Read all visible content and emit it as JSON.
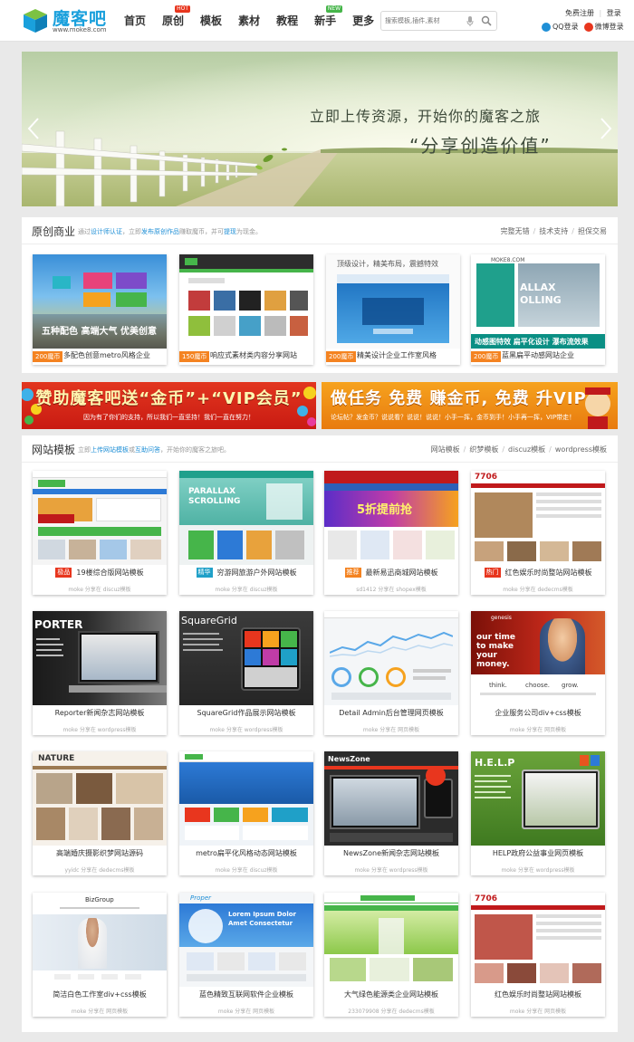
{
  "header": {
    "logo_text": "魔客吧",
    "logo_url": "www.moke8.com",
    "nav": [
      {
        "label": "首页"
      },
      {
        "label": "原创",
        "badge": "HOT"
      },
      {
        "label": "模板"
      },
      {
        "label": "素材"
      },
      {
        "label": "教程"
      },
      {
        "label": "新手",
        "badge": "NEW"
      },
      {
        "label": "更多"
      }
    ],
    "search_placeholder": "搜索模板,插件,素材",
    "register": "免费注册",
    "login": "登录",
    "qq_login": "QQ登录",
    "weibo_login": "微博登录"
  },
  "banner": {
    "headline": "立即上传资源，开始你的魔客之旅",
    "slogan": "“分享创造价值”"
  },
  "original": {
    "title": "原创商业",
    "desc_1": "通过",
    "desc_link_1": "设计师认证",
    "desc_2": "，立即",
    "desc_link_2": "发布原创作品",
    "desc_3": "赚取魔币，并可",
    "desc_link_3": "提现",
    "desc_4": "为现金。",
    "links": [
      "完整无错",
      "技术支持",
      "担保交易"
    ],
    "items": [
      {
        "price": "200魔币",
        "name": "多配色创意metro风格企业",
        "overlay_1": "五种配色 高端大气 优美创意"
      },
      {
        "price": "150魔币",
        "name": "响应式素材类内容分享网站",
        "overlay_1": ""
      },
      {
        "price": "200魔币",
        "name": "精美设计企业工作室风格",
        "overlay_1": "顶级设计，精美布局，震撼特效"
      },
      {
        "price": "200魔币",
        "name": "蓝黑扁平动感网站企业",
        "overlay_1": "动感图特效  扁平化设计  瀑布流效果",
        "overlay_2": "ALLAX",
        "overlay_3": "OLLING",
        "logo": "MOKE8.COM"
      }
    ]
  },
  "ads": {
    "ad1_title": "赞助魔客吧送“金币”+“VIP会员”",
    "ad1_sub": "因为有了你们的支持，所以我们一直坚持！我们一直在努力！",
    "ad2_title": "做任务 免费 赚金币, 免费 升VIP",
    "ad2_sub": "论坛帖？发金币？说说看？说说！说说！小手一挥，金币到手！小手再一挥，VIP带走！"
  },
  "templates": {
    "title": "网站模板",
    "desc_1": "立即",
    "desc_link_1": "上传网站模板",
    "desc_2": "或",
    "desc_link_2": "互助问答",
    "desc_3": "，开始你的魔客之旅吧。",
    "links": [
      "网站模板",
      "织梦模板",
      "discuz模板",
      "wordpress模板"
    ],
    "items": [
      {
        "tag": "极品",
        "name": "19楼综合版网站模板",
        "meta": "moke 分享在 discuz模板"
      },
      {
        "tag": "精华",
        "name": "穷游网旅游户外网站模板",
        "meta": "moke 分享在 discuz模板",
        "thumb_text_1": "PARALLAX",
        "thumb_text_2": "SCROLLING"
      },
      {
        "tag": "推荐",
        "name": "最新易迅商城网站模板",
        "meta": "sd1412 分享在 shopex模板",
        "thumb_text_1": "5折提前抢"
      },
      {
        "tag": "热门",
        "name": "红色娱乐时尚整站网站模板",
        "meta": "moke 分享在 dedecms模板",
        "thumb_text_1": "7706"
      },
      {
        "tag": "",
        "name": "Reporter新闻杂志网站模板",
        "meta": "moke 分享在 wordpress模板",
        "thumb_text_1": "PORTER"
      },
      {
        "tag": "",
        "name": "SquareGrid作品展示网站模板",
        "meta": "moke 分享在 wordpress模板",
        "thumb_text_1": "SquareGrid"
      },
      {
        "tag": "",
        "name": "Detail Admin后台管理网页模板",
        "meta": "moke 分享在 网页模板"
      },
      {
        "tag": "",
        "name": "企业服务公司div+css模板",
        "meta": "moke 分享在 网页模板",
        "thumb_text_1": "genesis",
        "thumb_text_2": "our time",
        "thumb_text_3": "to make",
        "thumb_text_4": "your",
        "thumb_text_5": "money.",
        "thumb_text_6": "think.",
        "thumb_text_7": "choose.",
        "thumb_text_8": "grow."
      },
      {
        "tag": "",
        "name": "高端婚庆摄影织梦网站源码",
        "meta": "yyidc 分享在 dedecms模板",
        "thumb_text_1": "NATURE"
      },
      {
        "tag": "",
        "name": "metro扁平化风格动态网站模板",
        "meta": "moke 分享在 discuz模板"
      },
      {
        "tag": "",
        "name": "NewsZone新闻杂志网站模板",
        "meta": "moke 分享在 wordpress模板",
        "thumb_text_1": "NewsZone"
      },
      {
        "tag": "",
        "name": "HELP政府公益事业网页模板",
        "meta": "moke 分享在 wordpress模板",
        "thumb_text_1": "H.E.L.P"
      },
      {
        "tag": "",
        "name": "简洁白色工作室div+css模板",
        "meta": "moke 分享在 网页模板",
        "thumb_text_1": "BizGroup"
      },
      {
        "tag": "",
        "name": "蓝色精致互联网软件企业模板",
        "meta": "moke 分享在 网页模板",
        "thumb_text_1": "Lorem Ipsum Dolor",
        "thumb_text_2": "Amet Consectetur"
      },
      {
        "tag": "",
        "name": "大气绿色能源类企业网站模板",
        "meta": "233079908 分享在 dedecms模板"
      },
      {
        "tag": "",
        "name": "红色娱乐时尚整站网站模板",
        "meta": "moke 分享在 网页模板",
        "thumb_text_1": "7706"
      }
    ]
  },
  "colors": {
    "brand_blue": "#1aa0dc",
    "link_blue": "#1f8fd6",
    "orange": "#f48321",
    "red": "#e8361e"
  }
}
